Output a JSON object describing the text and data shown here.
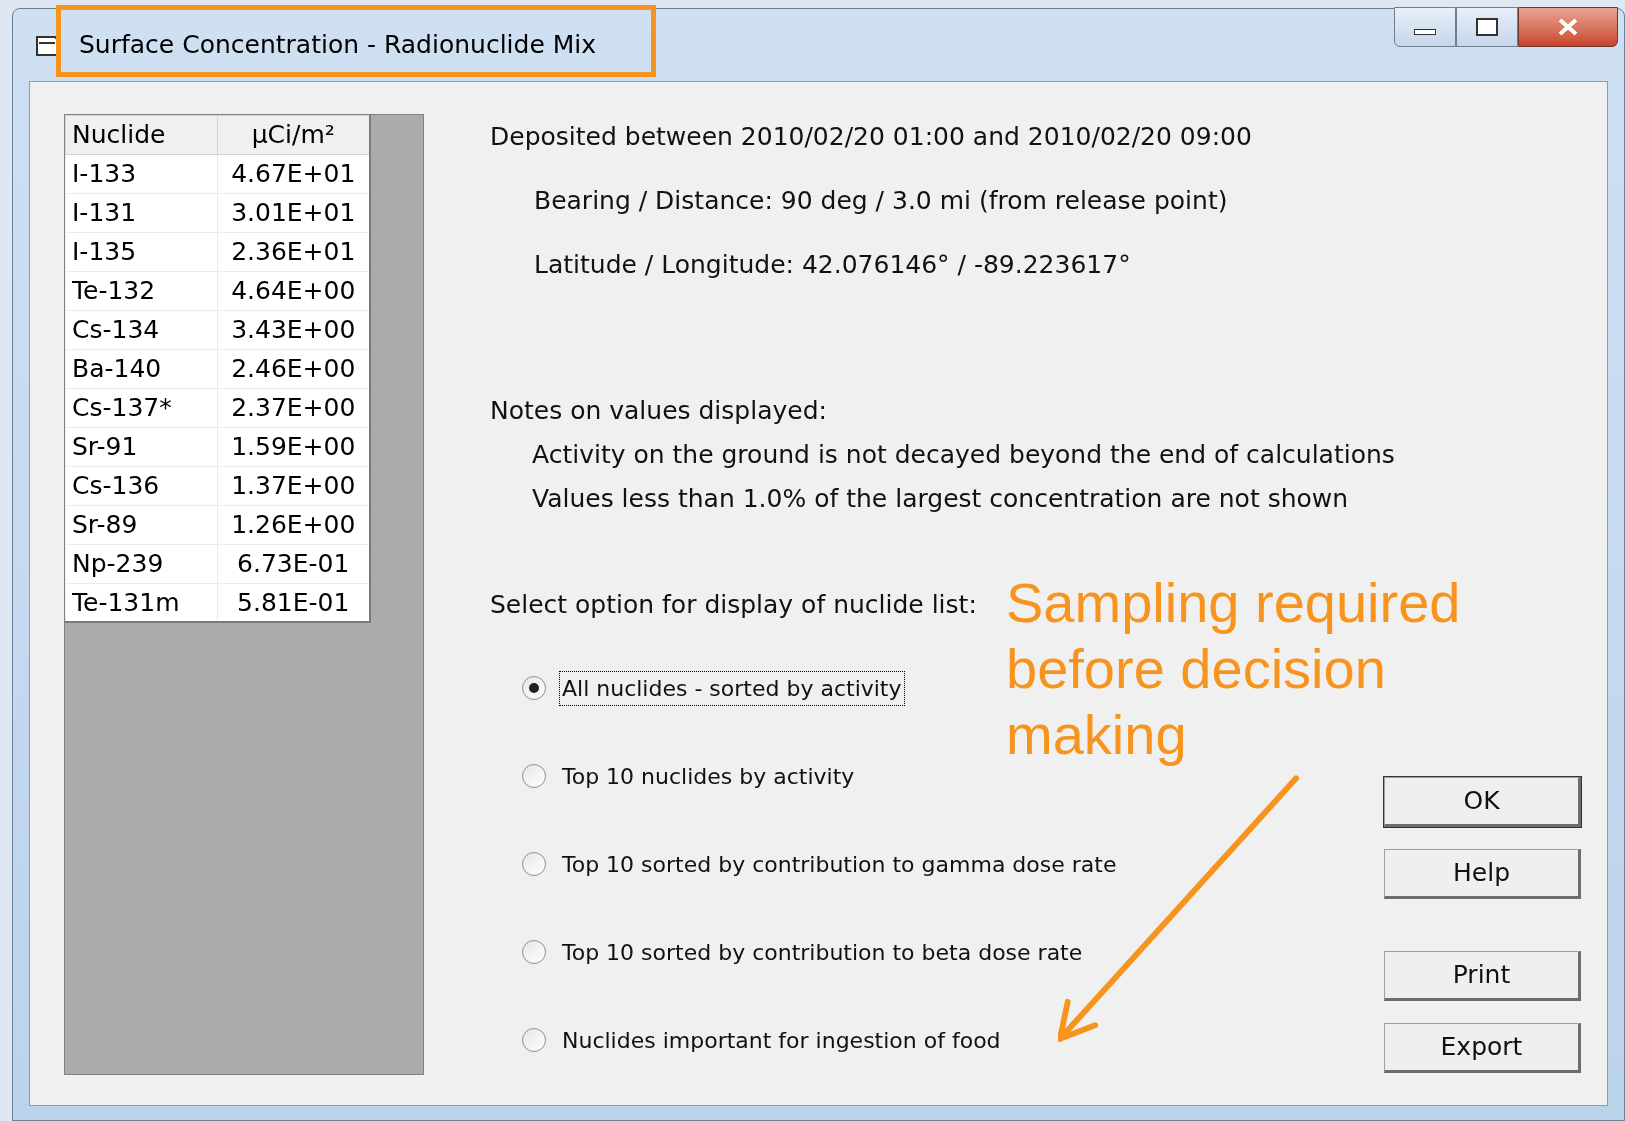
{
  "window": {
    "title": "Surface Concentration - Radionuclide Mix"
  },
  "table": {
    "columns": [
      "Nuclide",
      "µCi/m²"
    ],
    "rows": [
      [
        "I-133",
        "4.67E+01"
      ],
      [
        "I-131",
        "3.01E+01"
      ],
      [
        "I-135",
        "2.36E+01"
      ],
      [
        "Te-132",
        "4.64E+00"
      ],
      [
        "Cs-134",
        "3.43E+00"
      ],
      [
        "Ba-140",
        "2.46E+00"
      ],
      [
        "Cs-137*",
        "2.37E+00"
      ],
      [
        "Sr-91",
        "1.59E+00"
      ],
      [
        "Cs-136",
        "1.37E+00"
      ],
      [
        "Sr-89",
        "1.26E+00"
      ],
      [
        "Np-239",
        "6.73E-01"
      ],
      [
        "Te-131m",
        "5.81E-01"
      ]
    ]
  },
  "deposited": "Deposited between 2010/02/20 01:00 and 2010/02/20 09:00",
  "bearing": "Bearing / Distance: 90 deg / 3.0 mi (from release point)",
  "latlon": "Latitude / Longitude: 42.076146° / -89.223617°",
  "notes_heading": "Notes on values displayed:",
  "notes": [
    "Activity on the ground is not decayed beyond the end of calculations",
    "Values less than 1.0% of the largest concentration are not shown"
  ],
  "options_heading": "Select option for display of nuclide list:",
  "options": [
    {
      "label": "All nuclides - sorted by activity",
      "selected": true
    },
    {
      "label": "Top 10 nuclides by activity",
      "selected": false
    },
    {
      "label": "Top 10 sorted by contribution to gamma dose rate",
      "selected": false
    },
    {
      "label": "Top 10 sorted by contribution to beta dose rate",
      "selected": false
    },
    {
      "label": "Nuclides important for ingestion of food",
      "selected": false
    }
  ],
  "buttons": [
    "OK",
    "Help",
    "Print",
    "Export"
  ],
  "annotation": {
    "text": "Sampling required before decision making",
    "color": "#f7941d"
  }
}
